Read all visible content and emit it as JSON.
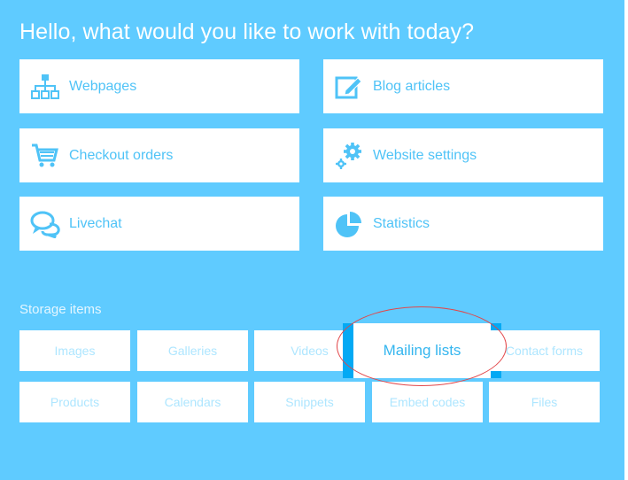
{
  "header": {
    "greeting": "Hello, what would you like to work with today?"
  },
  "cards": [
    {
      "label": "Webpages",
      "icon": "sitemap-icon"
    },
    {
      "label": "Blog articles",
      "icon": "edit-icon"
    },
    {
      "label": "Checkout orders",
      "icon": "shopping-cart-icon"
    },
    {
      "label": "Website settings",
      "icon": "gears-icon"
    },
    {
      "label": "Livechat",
      "icon": "chat-bubbles-icon"
    },
    {
      "label": "Statistics",
      "icon": "pie-chart-icon"
    }
  ],
  "storage": {
    "title": "Storage items",
    "items": [
      {
        "label": "Images"
      },
      {
        "label": "Galleries"
      },
      {
        "label": "Videos"
      },
      {
        "label": "Mailing lists",
        "highlighted": true
      },
      {
        "label": "Contact forms"
      },
      {
        "label": "Products"
      },
      {
        "label": "Calendars"
      },
      {
        "label": "Snippets"
      },
      {
        "label": "Embed codes"
      },
      {
        "label": "Files"
      }
    ]
  },
  "colors": {
    "background": "#5fcbff",
    "accent": "#4fc3f7",
    "highlight": "#03a9f4",
    "annotation": "#e2474a"
  }
}
